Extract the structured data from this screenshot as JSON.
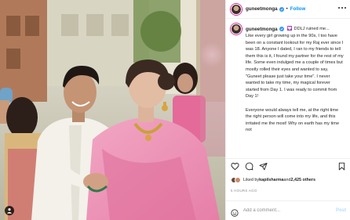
{
  "post": {
    "username": "guneetmonga",
    "follow_label": "Follow",
    "separator": "•",
    "verified_icon": "verified-badge-icon",
    "more_icon": "more-horizontal-icon"
  },
  "caption": {
    "username": "guneetmonga",
    "inline_emoji": "💟",
    "inline_text": "DDLJ ruined me...",
    "paragraphs": [
      "Like every girl growing up in the 90s, I too have been on a constant lookout for my Raj ever since I was 18. Anyone I dated, I ran to my friends to tell them this is it, I found my partner for the rest of my life. Some even indulged me a couple of times but mostly rolled their eyes and wanted to say, \"Guneet please just take your time\". I never wanted to take my time, my magical forever started from Day 1. I was ready to commit from Day 1!",
      "Everyone would always tell me, at the right time the right person will come into my life, and this irritated me the most! Why on earth has my time not"
    ]
  },
  "actions": {
    "icons": [
      "heart-icon",
      "comment-icon",
      "share-icon",
      "bookmark-icon"
    ]
  },
  "likes": {
    "prefix": "Liked by ",
    "user": "kapilsharma",
    "middle": " and ",
    "others": "2,425 others"
  },
  "timestamp": "5 HOURS AGO",
  "comment_box": {
    "placeholder": "Add a comment...",
    "post_label": "Post"
  },
  "colors": {
    "accent_blue": "#0095f6",
    "post_disabled": "#b2dffc",
    "muted_text": "#8e8e8e",
    "divider": "#efefef"
  }
}
